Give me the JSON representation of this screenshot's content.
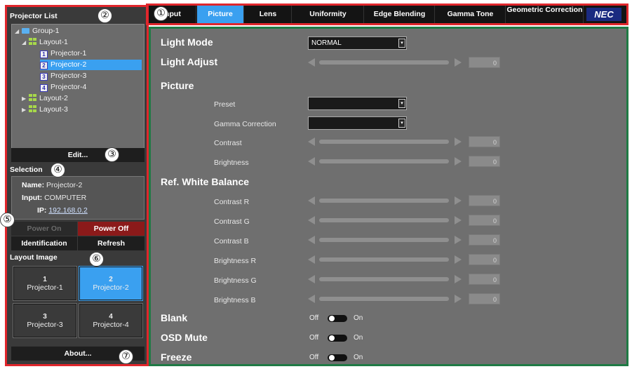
{
  "markers": [
    "①",
    "②",
    "③",
    "④",
    "⑤",
    "⑥",
    "⑦"
  ],
  "left": {
    "title": "Projector List",
    "tree": [
      {
        "label": "Group-1",
        "level": 0,
        "kind": "folder",
        "expanded": true
      },
      {
        "label": "Layout-1",
        "level": 1,
        "kind": "layout",
        "expanded": true
      },
      {
        "label": "Projector-1",
        "level": 2,
        "kind": "projector",
        "num": "1"
      },
      {
        "label": "Projector-2",
        "level": 2,
        "kind": "projector",
        "num": "2",
        "selected": true
      },
      {
        "label": "Projector-3",
        "level": 2,
        "kind": "projector",
        "num": "3"
      },
      {
        "label": "Projector-4",
        "level": 2,
        "kind": "projector",
        "num": "4"
      },
      {
        "label": "Layout-2",
        "level": 1,
        "kind": "layout",
        "expanded": false
      },
      {
        "label": "Layout-3",
        "level": 1,
        "kind": "layout",
        "expanded": false
      }
    ],
    "edit_label": "Edit...",
    "selection_title": "Selection",
    "selection": {
      "name_label": "Name:",
      "name_value": "Projector-2",
      "input_label": "Input:",
      "input_value": "COMPUTER",
      "ip_label": "IP:",
      "ip_value": "192.168.0.2"
    },
    "power_on_label": "Power On",
    "power_off_label": "Power Off",
    "identification_label": "Identification",
    "refresh_label": "Refresh",
    "layout_title": "Layout Image",
    "tiles": [
      {
        "num": "1",
        "label": "Projector-1",
        "selected": false
      },
      {
        "num": "2",
        "label": "Projector-2",
        "selected": true
      },
      {
        "num": "3",
        "label": "Projector-3",
        "selected": false
      },
      {
        "num": "4",
        "label": "Projector-4",
        "selected": false
      }
    ],
    "about_label": "About..."
  },
  "tabs": [
    {
      "label": "Input",
      "active": false
    },
    {
      "label": "Picture",
      "active": true
    },
    {
      "label": "Lens",
      "active": false
    },
    {
      "label": "Uniformity",
      "active": false
    },
    {
      "label": "Edge Blending",
      "active": false
    },
    {
      "label": "Gamma Tone",
      "active": false
    },
    {
      "label": "Geometric Correction",
      "active": false
    }
  ],
  "brand": "NEC",
  "content": {
    "light_mode_label": "Light Mode",
    "light_mode_value": "NORMAL",
    "light_adjust_label": "Light Adjust",
    "light_adjust_value": "0",
    "picture_label": "Picture",
    "preset_label": "Preset",
    "gamma_label": "Gamma Correction",
    "contrast_label": "Contrast",
    "contrast_value": "0",
    "brightness_label": "Brightness",
    "brightness_value": "0",
    "rwb_label": "Ref. White Balance",
    "rwb": [
      {
        "label": "Contrast R",
        "value": "0"
      },
      {
        "label": "Contrast G",
        "value": "0"
      },
      {
        "label": "Contrast B",
        "value": "0"
      },
      {
        "label": "Brightness R",
        "value": "0"
      },
      {
        "label": "Brightness G",
        "value": "0"
      },
      {
        "label": "Brightness B",
        "value": "0"
      }
    ],
    "toggles": [
      {
        "label": "Blank",
        "off": "Off",
        "on": "On"
      },
      {
        "label": "OSD Mute",
        "off": "Off",
        "on": "On"
      },
      {
        "label": "Freeze",
        "off": "Off",
        "on": "On"
      }
    ]
  }
}
